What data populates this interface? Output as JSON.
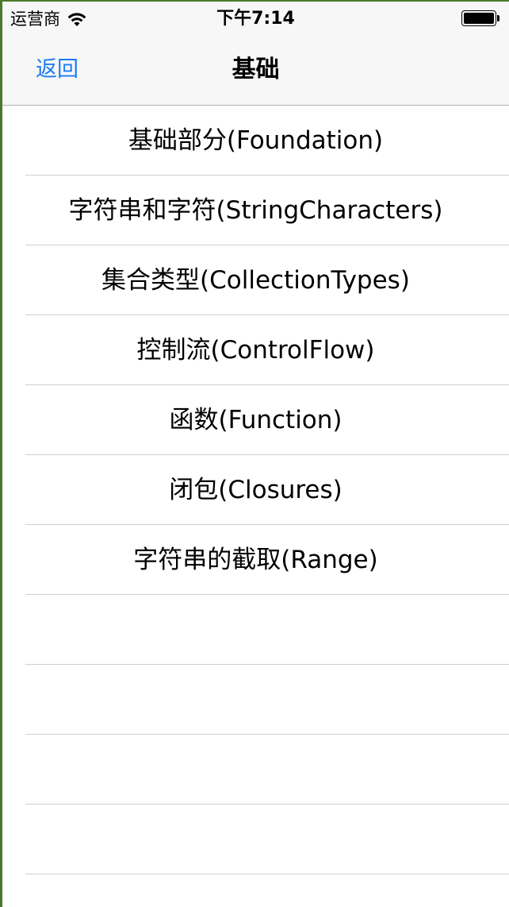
{
  "status_bar": {
    "carrier": "运营商",
    "time": "下午7:14",
    "icons": [
      "wifi-icon",
      "battery-icon"
    ]
  },
  "nav": {
    "back_label": "返回",
    "title": "基础"
  },
  "colors": {
    "accent": "#1a7cf4",
    "separator": "#cfcfcf",
    "navbar_bg": "#f7f7f7"
  },
  "list": {
    "items": [
      {
        "label": "基础部分(Foundation)"
      },
      {
        "label": "字符串和字符(StringCharacters)"
      },
      {
        "label": "集合类型(CollectionTypes)"
      },
      {
        "label": "控制流(ControlFlow)"
      },
      {
        "label": "函数(Function)"
      },
      {
        "label": "闭包(Closures)"
      },
      {
        "label": "字符串的截取(Range)"
      },
      {
        "label": ""
      },
      {
        "label": ""
      },
      {
        "label": ""
      },
      {
        "label": ""
      }
    ]
  }
}
